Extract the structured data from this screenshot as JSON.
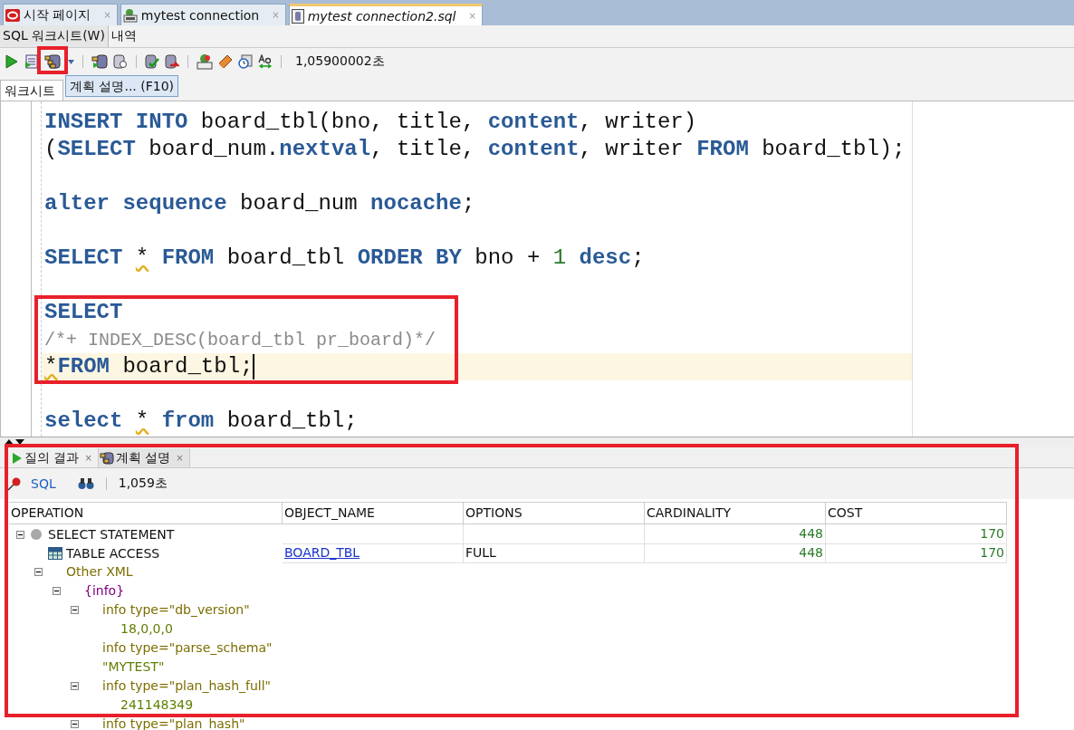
{
  "doc_tabs": [
    {
      "label": "시작 페이지",
      "kind": "start",
      "close": "×",
      "selected": false
    },
    {
      "label": "mytest connection",
      "kind": "connection",
      "close": "×",
      "selected": false
    },
    {
      "label": "mytest connection2.sql",
      "kind": "file",
      "close": "×",
      "selected": true
    }
  ],
  "editor_tabs": [
    {
      "label": "SQL 워크시트(W)",
      "selected": true
    },
    {
      "label": "내역",
      "selected": false
    }
  ],
  "toolbar": {
    "elapsed": "1,05900002초",
    "explain_framed": true,
    "tooltip": "계획 설명... (F10)"
  },
  "sheet_tabs": [
    {
      "label": "워크시트",
      "selected": true
    }
  ],
  "code_blocks": [
    {
      "framed": false,
      "lines": [
        {
          "current": false,
          "tokens": [
            {
              "kind": "kw",
              "text": "INSERT"
            },
            {
              "kind": "kw",
              "text": " INTO"
            },
            {
              "kind": "plain",
              "text": " board_tbl(bno, title, "
            },
            {
              "kind": "kw",
              "text": "content"
            },
            {
              "kind": "plain",
              "text": ", writer)"
            }
          ]
        },
        {
          "current": false,
          "tokens": [
            {
              "kind": "plain",
              "text": "("
            },
            {
              "kind": "kw",
              "text": "SELECT"
            },
            {
              "kind": "plain",
              "text": " board_num."
            },
            {
              "kind": "kw",
              "text": "nextval"
            },
            {
              "kind": "plain",
              "text": ", title, "
            },
            {
              "kind": "kw",
              "text": "content"
            },
            {
              "kind": "plain",
              "text": ", writer "
            },
            {
              "kind": "kw",
              "text": "FROM"
            },
            {
              "kind": "plain",
              "text": " board_tbl);"
            }
          ]
        },
        {
          "current": false
        },
        {
          "current": false,
          "tokens": [
            {
              "kind": "kw",
              "text": "alter"
            },
            {
              "kind": "kw",
              "text": " sequence"
            },
            {
              "kind": "plain",
              "text": " board_num "
            },
            {
              "kind": "kw",
              "text": "nocache"
            },
            {
              "kind": "plain",
              "text": ";"
            }
          ]
        },
        {
          "current": false
        },
        {
          "current": false,
          "tokens": [
            {
              "kind": "kw",
              "text": "SELECT "
            },
            {
              "kind": "flagged",
              "text": "*"
            },
            {
              "kind": "kw",
              "text": " FROM"
            },
            {
              "kind": "plain",
              "text": " board_tbl "
            },
            {
              "kind": "kw",
              "text": "ORDER BY"
            },
            {
              "kind": "plain",
              "text": " bno + "
            },
            {
              "kind": "num",
              "text": "1"
            },
            {
              "kind": "kw",
              "text": " desc"
            },
            {
              "kind": "plain",
              "text": ";"
            }
          ]
        },
        {
          "current": false
        }
      ]
    },
    {
      "framed": true,
      "lines": [
        {
          "current": false,
          "tokens": [
            {
              "kind": "kw",
              "text": "SELECT"
            }
          ]
        },
        {
          "current": false,
          "tokens": [
            {
              "kind": "comment",
              "text": "/*+ INDEX_DESC(board_tbl pr_board)*/"
            }
          ]
        },
        {
          "current": true,
          "tokens": [
            {
              "kind": "flagged",
              "text": "*"
            },
            {
              "kind": "kw",
              "text": "FROM"
            },
            {
              "kind": "plain",
              "text": " board_tbl;"
            }
          ]
        }
      ]
    },
    {
      "framed": false,
      "lines": [
        {
          "current": false
        },
        {
          "current": false,
          "tokens": [
            {
              "kind": "kw",
              "text": "select "
            },
            {
              "kind": "flagged",
              "text": "*"
            },
            {
              "kind": "kw",
              "text": " from"
            },
            {
              "kind": "plain",
              "text": " board_tbl;"
            }
          ]
        }
      ]
    }
  ],
  "results": {
    "framed": true,
    "tabs": [
      {
        "label": "질의 결과",
        "kind": "query",
        "close": "×",
        "selected": false
      },
      {
        "label": "계획 설명",
        "kind": "plan",
        "close": "×",
        "selected": true
      }
    ],
    "sql_link": "SQL",
    "elapsed": "1,059초",
    "columns": [
      "OPERATION",
      "OBJECT_NAME",
      "OPTIONS",
      "CARDINALITY",
      "COST"
    ],
    "rows": [
      {
        "kind": "statement",
        "operation": "SELECT STATEMENT",
        "cardinality": "448",
        "cost": "170",
        "expanded": true,
        "children": [
          {
            "kind": "table_access",
            "operation": "TABLE ACCESS",
            "object_name": "BOARD_TBL",
            "options": "FULL",
            "cardinality": "448",
            "cost": "170"
          },
          {
            "kind": "xml",
            "operation": "Other XML",
            "expanded": true,
            "children": [
              {
                "kind": "tag",
                "operation": "{info}",
                "expanded": true,
                "children": [
                  {
                    "kind": "xml",
                    "operation": "info type=\"db_version\"",
                    "expanded": true,
                    "children": [
                      {
                        "kind": "value",
                        "operation": "18,0,0,0"
                      }
                    ]
                  },
                  {
                    "kind": "xml",
                    "operation": "info type=\"parse_schema\""
                  },
                  {
                    "kind": "value",
                    "operation": "\"MYTEST\""
                  },
                  {
                    "kind": "xml",
                    "operation": "info type=\"plan_hash_full\"",
                    "expanded": true,
                    "children": [
                      {
                        "kind": "value",
                        "operation": "241148349"
                      }
                    ]
                  },
                  {
                    "kind": "xml",
                    "operation": "info type=\"plan_hash\"",
                    "expanded": true
                  }
                ]
              }
            ]
          }
        ]
      }
    ]
  }
}
